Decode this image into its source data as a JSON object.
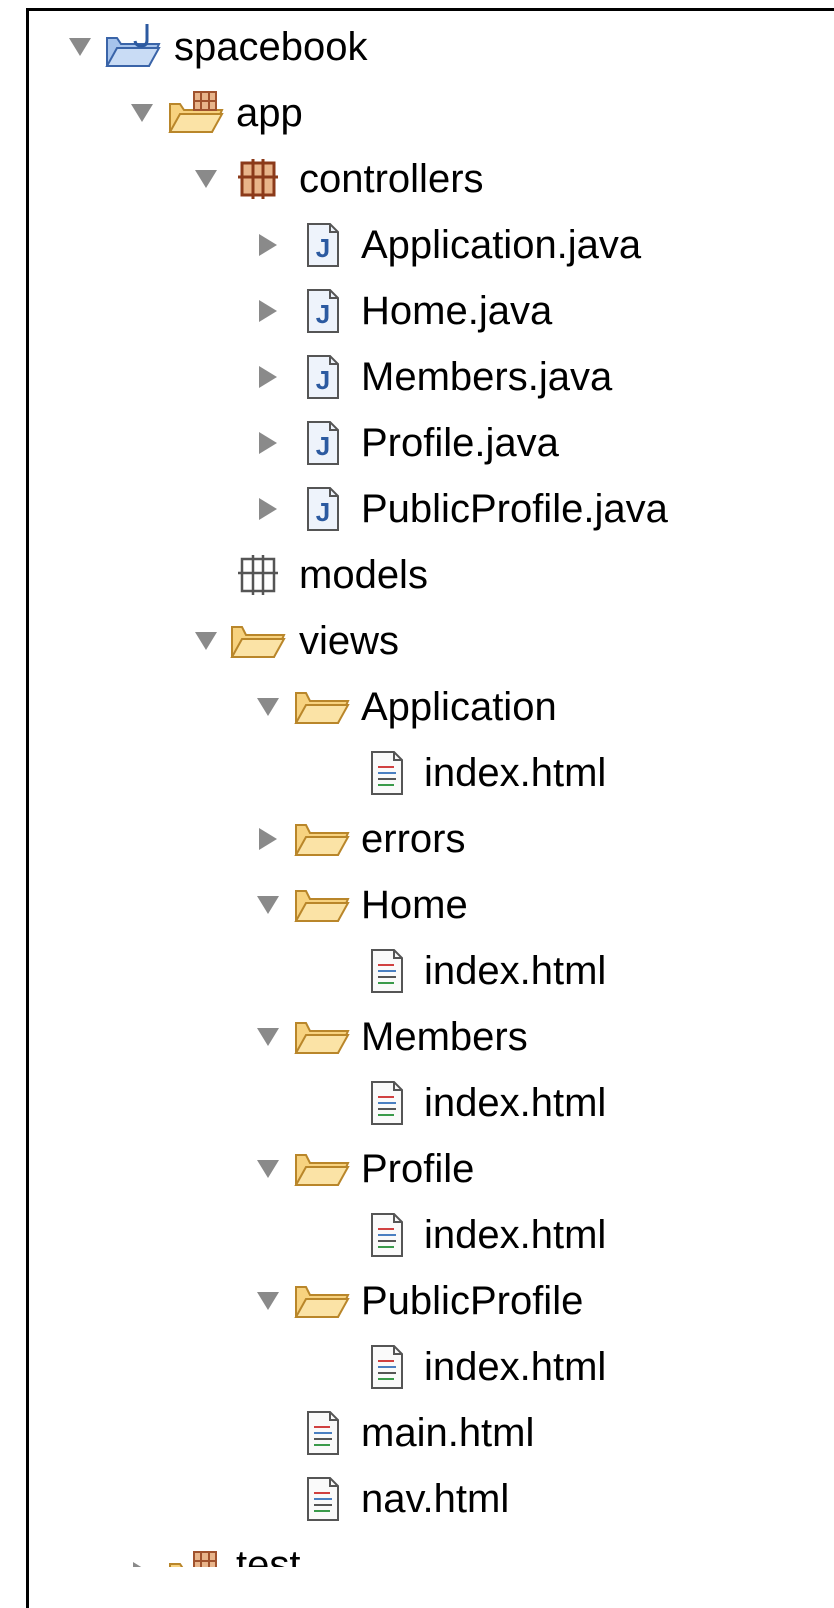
{
  "project": {
    "name": "spacebook",
    "children": {
      "app": {
        "label": "app",
        "controllers": {
          "label": "controllers",
          "files": [
            "Application.java",
            "Home.java",
            "Members.java",
            "Profile.java",
            "PublicProfile.java"
          ]
        },
        "models": {
          "label": "models"
        },
        "views": {
          "label": "views",
          "application": {
            "label": "Application",
            "file": "index.html"
          },
          "errors": {
            "label": "errors"
          },
          "home": {
            "label": "Home",
            "file": "index.html"
          },
          "members": {
            "label": "Members",
            "file": "index.html"
          },
          "profile": {
            "label": "Profile",
            "file": "index.html"
          },
          "publicprofile": {
            "label": "PublicProfile",
            "file": "index.html"
          },
          "main": "main.html",
          "nav": "nav.html"
        }
      },
      "test": {
        "label": "test"
      }
    }
  },
  "icons": {
    "expanded": "triangle-down",
    "collapsed": "triangle-right",
    "project": "java-project-folder",
    "source_folder": "source-folder",
    "package": "package",
    "empty_package": "empty-package",
    "folder": "folder",
    "java_file": "java-file",
    "html_file": "html-file"
  },
  "colors": {
    "twisty": "#8a8a8a",
    "folder_fill": "#f7d27f",
    "folder_stroke": "#b9862a",
    "package": "#a0522d",
    "java_blue": "#2c5aa0"
  }
}
